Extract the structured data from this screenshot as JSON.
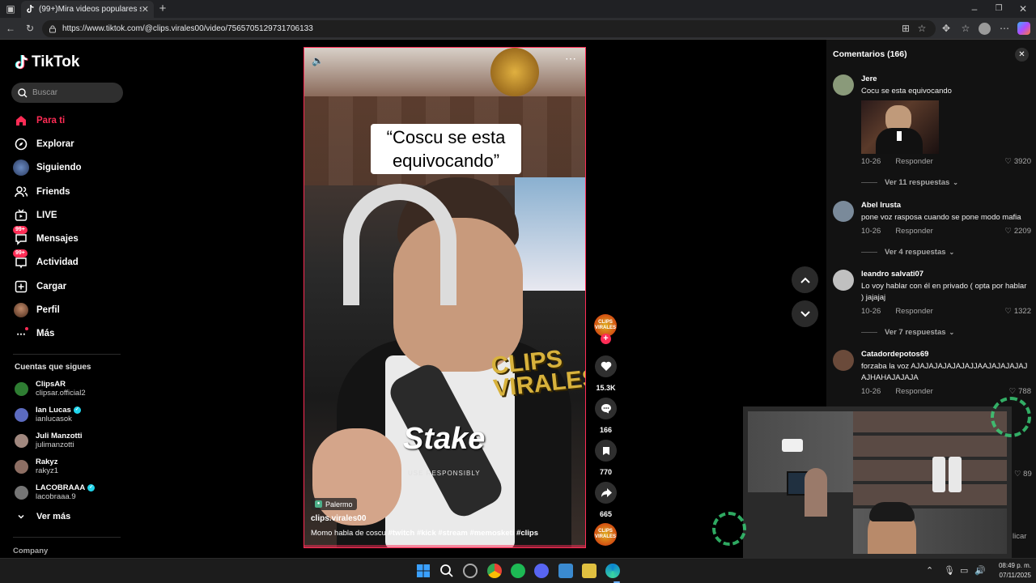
{
  "browser": {
    "tab_title": "(99+)Mira videos populares selec",
    "url": "https://www.tiktok.com/@clips.virales00/video/7565705129731706133"
  },
  "sidebar": {
    "logo": "TikTok",
    "search_placeholder": "Buscar",
    "nav": [
      {
        "label": "Para ti",
        "icon": "home-icon",
        "active": true
      },
      {
        "label": "Explorar",
        "icon": "compass-icon"
      },
      {
        "label": "Siguiendo",
        "icon": "following-avatar-icon"
      },
      {
        "label": "Friends",
        "icon": "friends-icon"
      },
      {
        "label": "LIVE",
        "icon": "live-tv-icon"
      },
      {
        "label": "Mensajes",
        "icon": "messages-icon",
        "badge": "99+"
      },
      {
        "label": "Actividad",
        "icon": "activity-icon",
        "badge": "99+"
      },
      {
        "label": "Cargar",
        "icon": "upload-icon"
      },
      {
        "label": "Perfil",
        "icon": "profile-avatar-icon"
      },
      {
        "label": "Más",
        "icon": "more-dots-icon"
      }
    ],
    "following_title": "Cuentas que sigues",
    "following": [
      {
        "name": "ClipsAR",
        "handle": "clipsar.official2",
        "verified": false,
        "color": "#2e7d32"
      },
      {
        "name": "Ian Lucas",
        "handle": "ianlucasok",
        "verified": true,
        "color": "#5c6bc0"
      },
      {
        "name": "Juli Manzotti",
        "handle": "julimanzotti",
        "verified": false,
        "color": "#a1887f"
      },
      {
        "name": "Rakyz",
        "handle": "rakyz1",
        "verified": false,
        "color": "#8d6e63"
      },
      {
        "name": "LACOBRAAA",
        "handle": "lacobraaa.9",
        "verified": true,
        "color": "#757575"
      }
    ],
    "see_more": "Ver más",
    "company": "Company"
  },
  "video": {
    "caption": "“Coscu se esta equivocando”",
    "watermark": "CLIPS VIRALES",
    "sponsor": "Stake",
    "sponsor_sub": "USE RESPONSIBLY",
    "location": "Palermo",
    "username": "clips.virales00",
    "description": "Momo habla de coscu",
    "hashtags": [
      "#twitch",
      "#kick",
      "#stream",
      "#memosketi",
      "#clips"
    ]
  },
  "actions": {
    "likes": "15.3K",
    "comments": "166",
    "saves": "770",
    "shares": "665",
    "creator_avatar_text": "CLIPS VIRALES"
  },
  "comments_panel": {
    "title": "Comentarios (166)",
    "items": [
      {
        "user": "Jere",
        "text": "Cocu se esta equivocando",
        "date": "10-26",
        "reply": "Responder",
        "likes": "3920",
        "replies": "Ver 11 respuestas",
        "has_gif": true,
        "avatar_color": "#8a9a7a"
      },
      {
        "user": "Abel Irusta",
        "text": "pone voz rasposa cuando se pone modo mafia",
        "date": "10-26",
        "reply": "Responder",
        "likes": "2209",
        "replies": "Ver 4 respuestas",
        "avatar_color": "#7a8a9a"
      },
      {
        "user": "leandro salvati07",
        "text": "Lo voy hablar con él en privado ( opta por hablar ) jajajaj",
        "date": "10-26",
        "reply": "Responder",
        "likes": "1322",
        "replies": "Ver 7 respuestas",
        "avatar_color": "#c0c0c0"
      },
      {
        "user": "Catadordepotos69",
        "text": "forzaba la voz AJAJAJAJAJAJAJJAAJAJAJAJAJAJHAHAJAJAJA",
        "date": "10-26",
        "reply": "Responder",
        "likes": "788",
        "avatar_color": "#6a4a3a"
      }
    ],
    "partial_likes": "89",
    "partial_text": "licar"
  },
  "taskbar": {
    "time": "08:49 p. m.",
    "date": "07/11/2025"
  }
}
